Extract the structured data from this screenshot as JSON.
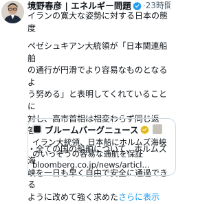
{
  "author": {
    "name": "境野春彦 | エネルギー問題",
    "verified_color": "#1d9bf0"
  },
  "timestamp": "23時間",
  "body_paragraphs": [
    [
      "イランの寛大な姿勢に対する日本の態度"
    ],
    [
      "ペゼシュキアン大統領が「日本関連船舶",
      "の通行が円滑でより容易なものとなるよ",
      "う努める」と表明してくれていることに",
      "対し、高市首相は相変わらず同じ返答。"
    ],
    [
      "・全ての国の船舶について、ホルムズ海",
      "峡を一日も早く自由で安全に通過できる",
      "ように改めて強く求めた"
    ]
  ],
  "show_more": "さらに表示",
  "quoted": {
    "publisher": "ブルームバーグニュース",
    "verified_color": "#e2b719",
    "headline_lines": [
      "イラン大統領、日本船にホルムズ海峡",
      "のいっそうの容易な通航を保証"
    ],
    "url": "bloomberg.co.jp/news/articl..."
  },
  "colors": {
    "link": "#1d9bf0",
    "muted": "#536471",
    "text": "#0f1419",
    "border": "#cfd9de"
  }
}
